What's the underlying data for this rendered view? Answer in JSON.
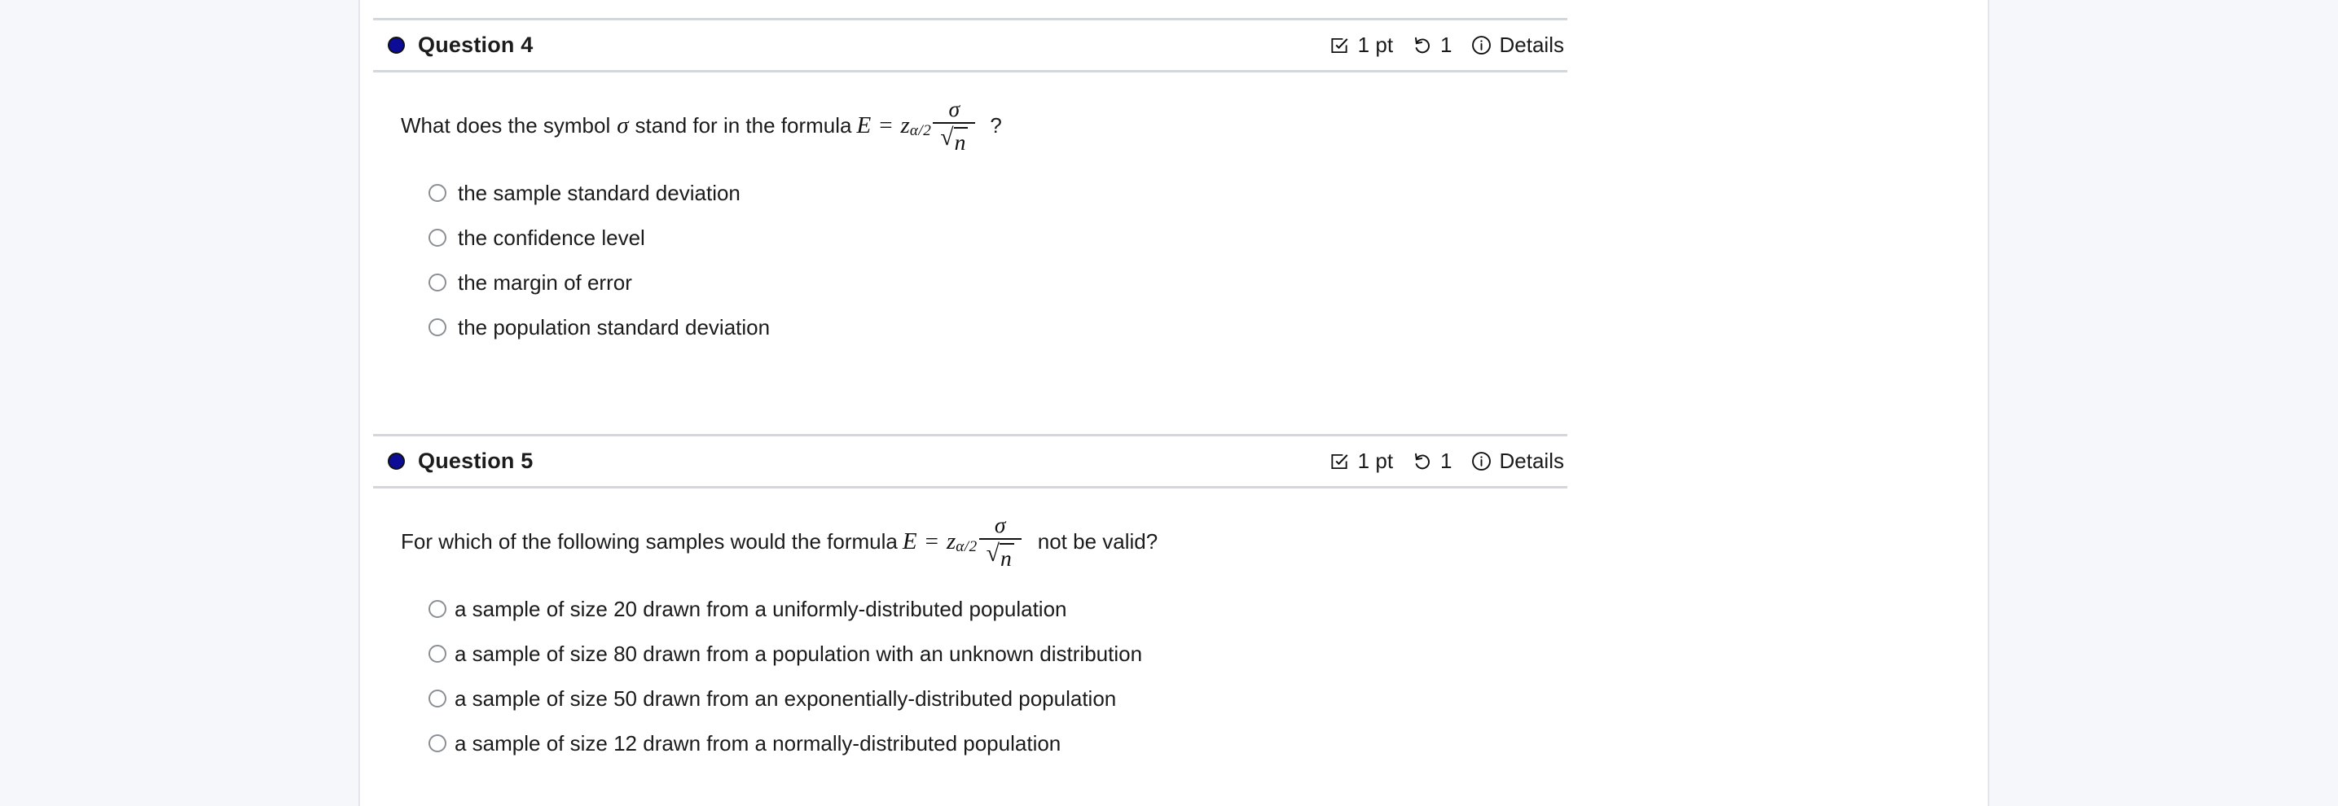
{
  "colors": {
    "page_background": "#f5f7fb",
    "panel_background": "#ffffff",
    "question_dot": "#0c0c96",
    "divider": "#d3d6db",
    "text": "#1b1b1b"
  },
  "questions": [
    {
      "number": "4",
      "name_label": "Question 4",
      "points_label": "1 pt",
      "attempts_label": "1",
      "details_label": "Details",
      "icons": {
        "points": "checkbox-check-icon",
        "attempts": "undo-retry-icon",
        "details": "info-circle-icon"
      },
      "prompt_prefix": "What does the symbol",
      "prompt_symbol": "σ",
      "prompt_middle": "stand for in the formula",
      "formula": {
        "lhs": "E",
        "equals": "=",
        "z": "z",
        "z_subscript": "α/2",
        "numerator": "σ",
        "denominator_radical": "√",
        "denominator_radicand": "n"
      },
      "prompt_suffix": "?",
      "options": [
        "the sample standard deviation",
        "the confidence level",
        "the margin of error",
        "the population standard deviation"
      ]
    },
    {
      "number": "5",
      "name_label": "Question 5",
      "points_label": "1 pt",
      "attempts_label": "1",
      "details_label": "Details",
      "icons": {
        "points": "checkbox-check-icon",
        "attempts": "undo-retry-icon",
        "details": "info-circle-icon"
      },
      "prompt_prefix": "For which of the following samples would the formula",
      "prompt_symbol": "",
      "prompt_middle": "",
      "formula": {
        "lhs": "E",
        "equals": "=",
        "z": "z",
        "z_subscript": "α/2",
        "numerator": "σ",
        "denominator_radical": "√",
        "denominator_radicand": "n"
      },
      "prompt_suffix": "not be valid?",
      "options": [
        "a sample of size 20 drawn from a uniformly-distributed population",
        "a sample of size 80 drawn from a population with an unknown distribution",
        "a sample of size 50 drawn from an exponentially-distributed population",
        "a sample of size 12 drawn from a normally-distributed population"
      ]
    }
  ]
}
